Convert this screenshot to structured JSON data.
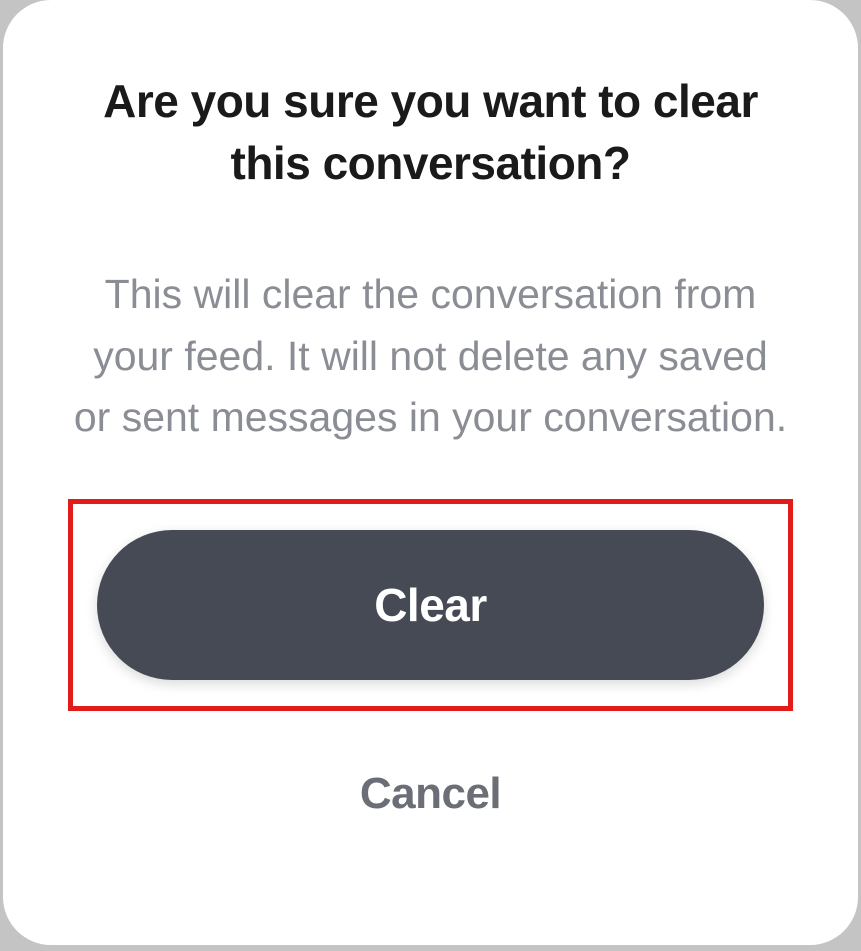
{
  "dialog": {
    "title": "Are you sure you want to clear this conversation?",
    "description": "This will clear the conversation from your feed. It will not delete any saved or sent messages in your conversation.",
    "clear_label": "Clear",
    "cancel_label": "Cancel"
  }
}
